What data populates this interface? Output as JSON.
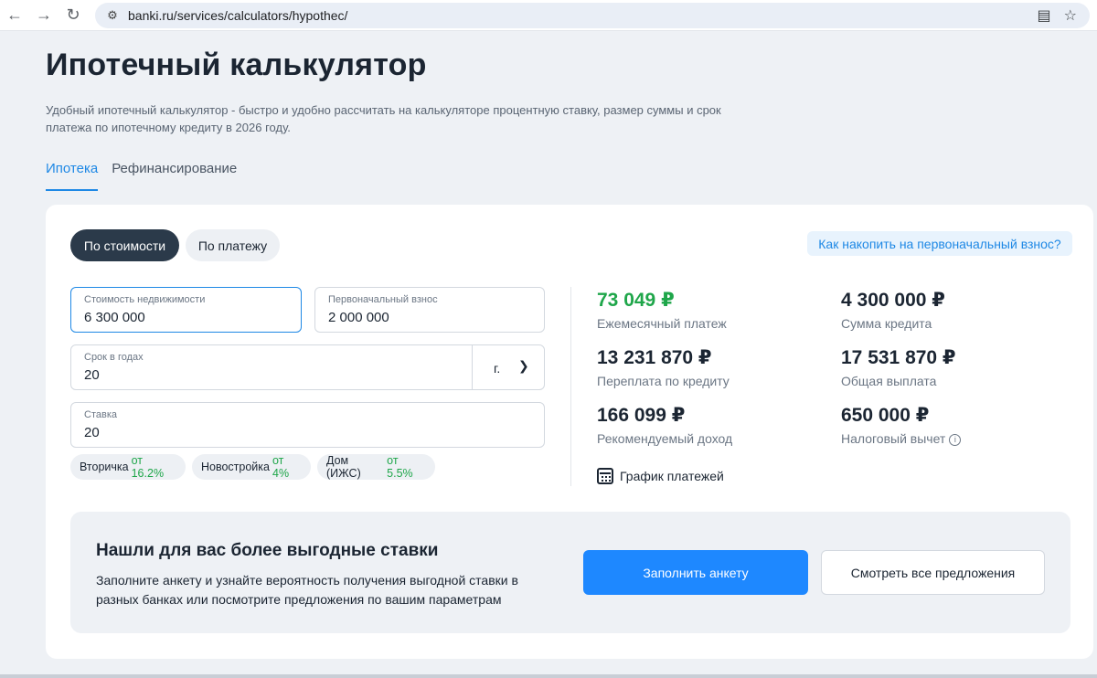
{
  "browser": {
    "url": "banki.ru/services/calculators/hypothec/"
  },
  "page": {
    "title": "Ипотечный калькулятор",
    "description": "Удобный ипотечный калькулятор - быстро и удобно рассчитать на калькуляторе процентную ставку, размер суммы и срок платежа по ипотечному кредиту в 2026 году."
  },
  "tabs": [
    {
      "label": "Ипотека",
      "active": true
    },
    {
      "label": "Рефинансирование",
      "active": false
    }
  ],
  "calculator": {
    "mode_options": [
      {
        "label": "По стоимости",
        "active": true
      },
      {
        "label": "По платежу",
        "active": false
      }
    ],
    "down_payment_link": "Как накопить на первоначальный взнос?",
    "property_cost": {
      "label": "Стоимость недвижимости",
      "value": "6 300 000"
    },
    "down_payment": {
      "label": "Первоначальный взнос",
      "value": "2 000 000"
    },
    "term": {
      "label": "Срок в годах",
      "value": "20",
      "unit": "г."
    },
    "rate": {
      "label": "Ставка",
      "value": "20"
    },
    "rate_chips": [
      {
        "name": "Вторичка",
        "rate": "от 16.2%"
      },
      {
        "name": "Новостройка",
        "rate": "от 4%"
      },
      {
        "name": "Дом (ИЖС)",
        "rate": "от 5.5%"
      }
    ]
  },
  "results": {
    "monthly_payment": {
      "value": "73 049 ₽",
      "caption": "Ежемесячный платеж"
    },
    "loan_amount": {
      "value": "4 300 000 ₽",
      "caption": "Сумма кредита"
    },
    "overpayment": {
      "value": "13 231 870 ₽",
      "caption": "Переплата по кредиту"
    },
    "total_payment": {
      "value": "17 531 870 ₽",
      "caption": "Общая выплата"
    },
    "recommended_income": {
      "value": "166 099 ₽",
      "caption": "Рекомендуемый доход"
    },
    "tax_deduction": {
      "value": "650 000 ₽",
      "caption": "Налоговый вычет"
    },
    "schedule_link": "График платежей"
  },
  "promo": {
    "title": "Нашли для вас более выгодные ставки",
    "text": "Заполните анкету и узнайте вероятность получения выгодной ставки в разных банках или посмотрите предложения по вашим параметрам",
    "primary_button": "Заполнить анкету",
    "secondary_button": "Смотреть все предложения"
  },
  "colors": {
    "accent": "#1e88e5",
    "primary_button": "#1e88ff",
    "positive": "#1fa64a",
    "dark": "#2b3a4a"
  }
}
